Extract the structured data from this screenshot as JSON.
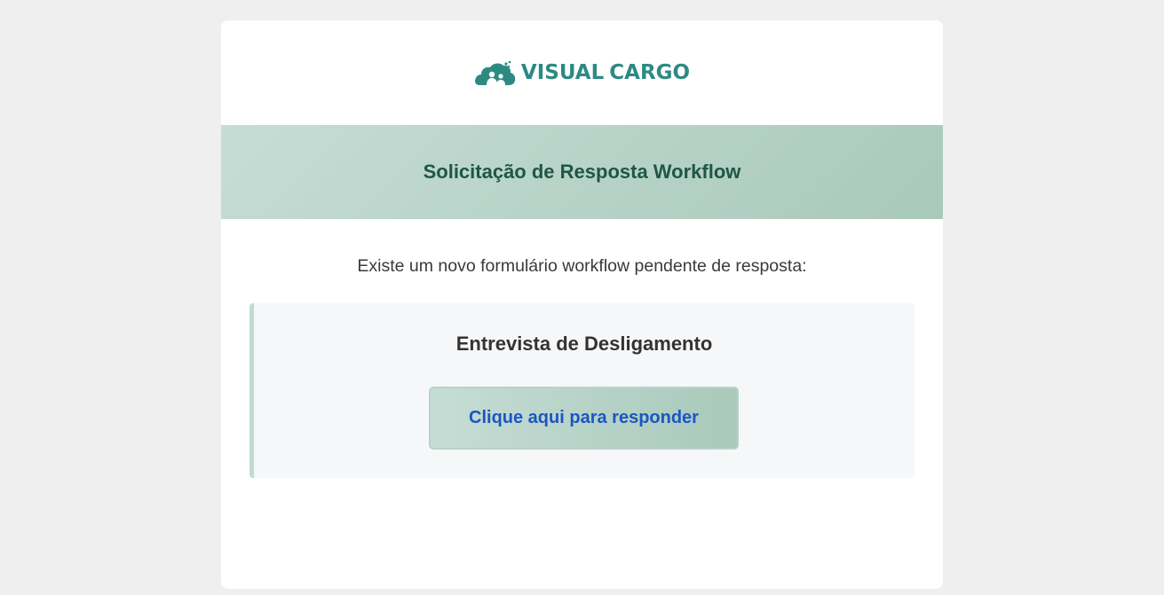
{
  "email": {
    "logo": {
      "word1": "VISUAL",
      "word2": "CARGO",
      "icon": "cloud-people-icon",
      "color": "#2d8a83"
    },
    "banner": {
      "title": "Solicitação de Resposta Workflow"
    },
    "intro_text": "Existe um novo formulário workflow pendente de resposta:",
    "form": {
      "name": "Entrevista de Desligamento",
      "button_label": "Clique aqui para responder"
    },
    "colors": {
      "page_background": "#efefef",
      "banner_gradient_start": "#c6ddd6",
      "banner_gradient_end": "#a9c9ba",
      "banner_title": "#1f5647",
      "link": "#1a56c4",
      "form_box_background": "#f6f7f9",
      "form_box_border": "#c1dbd3"
    }
  }
}
